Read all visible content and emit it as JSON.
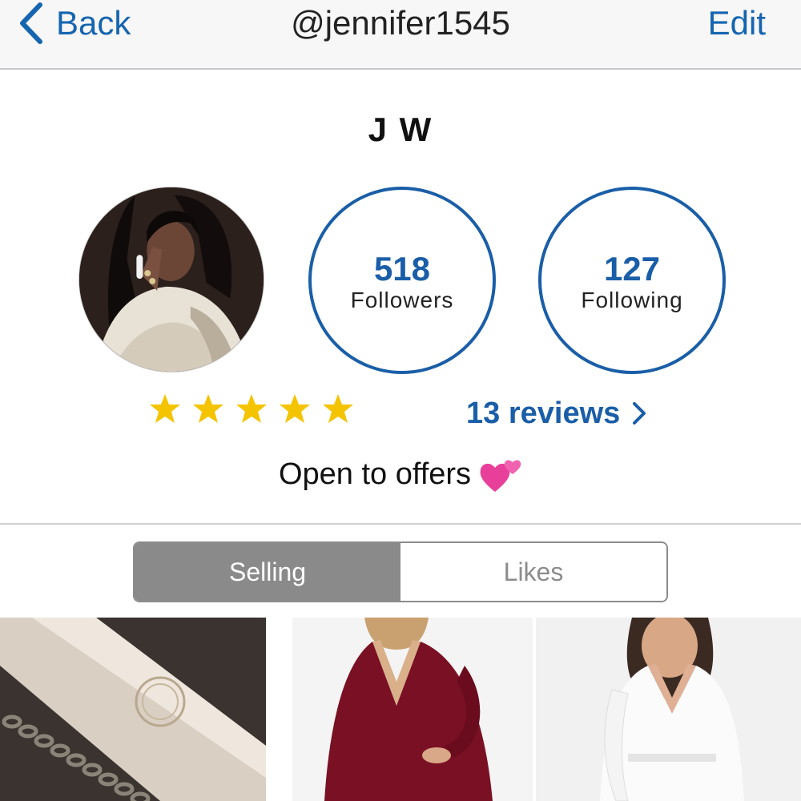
{
  "nav": {
    "back_label": "Back",
    "title": "@jennifer1545",
    "edit_label": "Edit"
  },
  "profile": {
    "name": "J W",
    "followers_count": "518",
    "followers_label": "Followers",
    "following_count": "127",
    "following_label": "Following",
    "rating": 5,
    "rating_max": 5,
    "reviews_label": "13 reviews",
    "bio": "Open to offers",
    "bio_emoji": "two-hearts-icon"
  },
  "tabs": [
    {
      "label": "Selling",
      "active": true
    },
    {
      "label": "Likes",
      "active": false
    }
  ],
  "listings": [
    {
      "name": "chain-bracelet-listing"
    },
    {
      "name": "burgundy-velvet-dress-listing"
    },
    {
      "name": "white-wrap-dress-listing"
    }
  ],
  "colors": {
    "accent": "#1a5ea8",
    "star": "#f5c400",
    "segment_active": "#8a8a8a"
  }
}
